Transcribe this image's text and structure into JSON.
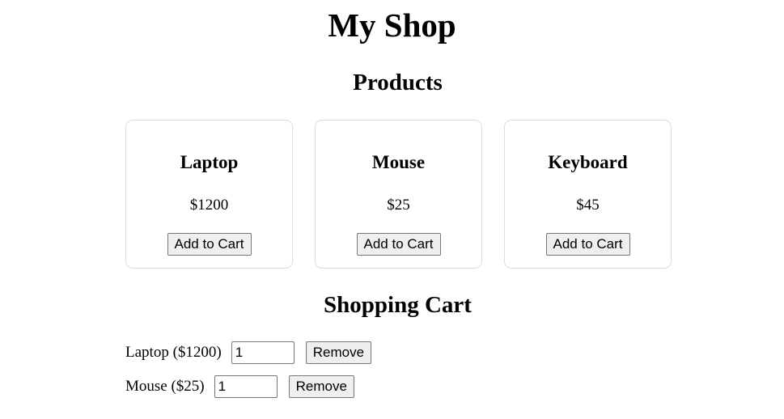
{
  "header": {
    "title": "My Shop"
  },
  "products": {
    "heading": "Products",
    "items": [
      {
        "name": "Laptop",
        "price": "$1200",
        "button_label": "Add to Cart"
      },
      {
        "name": "Mouse",
        "price": "$25",
        "button_label": "Add to Cart"
      },
      {
        "name": "Keyboard",
        "price": "$45",
        "button_label": "Add to Cart"
      }
    ]
  },
  "cart": {
    "heading": "Shopping Cart",
    "items": [
      {
        "label": "Laptop ($1200)",
        "quantity": "1",
        "remove_label": "Remove"
      },
      {
        "label": "Mouse ($25)",
        "quantity": "1",
        "remove_label": "Remove"
      }
    ]
  }
}
